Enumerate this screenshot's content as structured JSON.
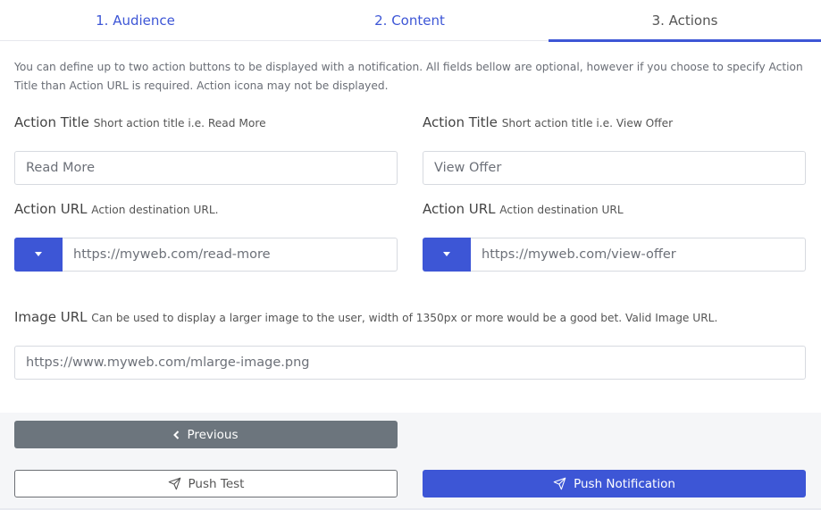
{
  "tabs": [
    {
      "label": "1. Audience"
    },
    {
      "label": "2. Content"
    },
    {
      "label": "3. Actions"
    }
  ],
  "intro": "You can define up to two action buttons to be displayed with a notification. All fields bellow are optional, however if you choose to specify Action Title than Action URL is required. Action icona may not be displayed.",
  "action1": {
    "title_label": "Action Title",
    "title_hint": "Short action title i.e. Read More",
    "title_value": "Read More",
    "url_label": "Action URL",
    "url_hint": "Action destination URL.",
    "url_value": "https://myweb.com/read-more"
  },
  "action2": {
    "title_label": "Action Title",
    "title_hint": "Short action title i.e. View Offer",
    "title_value": "View Offer",
    "url_label": "Action URL",
    "url_hint": "Action destination URL",
    "url_value": "https://myweb.com/view-offer"
  },
  "image": {
    "label": "Image URL",
    "hint": "Can be used to display a larger image to the user, width of 1350px or more would be a good bet. Valid Image URL.",
    "value": "https://www.myweb.com/mlarge-image.png"
  },
  "buttons": {
    "previous": "Previous",
    "push_test": "Push Test",
    "push_notification": "Push Notification"
  },
  "icons": {
    "previous": "chevron-left-icon",
    "push_test": "send-icon",
    "push_notification": "send-icon"
  },
  "colors": {
    "accent": "#3d56d6",
    "secondary": "#6c757d"
  }
}
